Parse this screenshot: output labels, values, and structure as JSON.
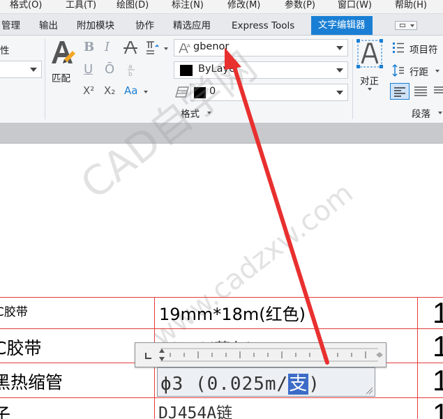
{
  "menubar": {
    "items": [
      "格式(O)",
      "工具(T)",
      "绘图(D)",
      "标注(N)",
      "修改(M)",
      "参数(P)",
      "窗口(W)",
      "帮助(H)"
    ]
  },
  "tabs": {
    "items": [
      "管理",
      "输出",
      "附加模块",
      "协作",
      "精选应用",
      "Express Tools",
      "文字编辑器"
    ],
    "active": "文字编辑器"
  },
  "ribbon": {
    "left_partial": "性",
    "match_label": "匹配",
    "bold_glyph": "B",
    "italic_glyph": "I",
    "underline_glyph": "U",
    "overline_glyph": "Ō",
    "superscript_glyph": "X²",
    "subscript_glyph": "X₂",
    "case_glyph": "Aa",
    "font": {
      "value": "gbenor"
    },
    "color": {
      "value": "ByLayer"
    },
    "oblique": {
      "value": "0"
    },
    "format_panel_label": "格式",
    "justify_label": "对正",
    "bullets_label": "项目符",
    "line_spacing_label": "行距",
    "paragraph_panel_label": "段落"
  },
  "table": {
    "rows": [
      {
        "name": "C胶带",
        "spec": "19mm*18m(红色)"
      },
      {
        "name": "C胶带",
        "spec": "20*18(蓝色)"
      },
      {
        "name": "黑热缩管",
        "spec": ""
      },
      {
        "name": "子",
        "spec": "DJ454A链"
      }
    ],
    "qty": [
      "1",
      "1",
      "1",
      "1"
    ]
  },
  "editor": {
    "text_before": "ϕ3 (0.025m/",
    "text_selected": "支",
    "text_after": ")"
  },
  "watermark": {
    "line1": "CAD自学网",
    "line2": "www.cadzxw.com"
  },
  "colors": {
    "accent": "#1a7fd4",
    "grid_lines": "#e33b3b",
    "annotation_arrow": "#e8302f"
  }
}
